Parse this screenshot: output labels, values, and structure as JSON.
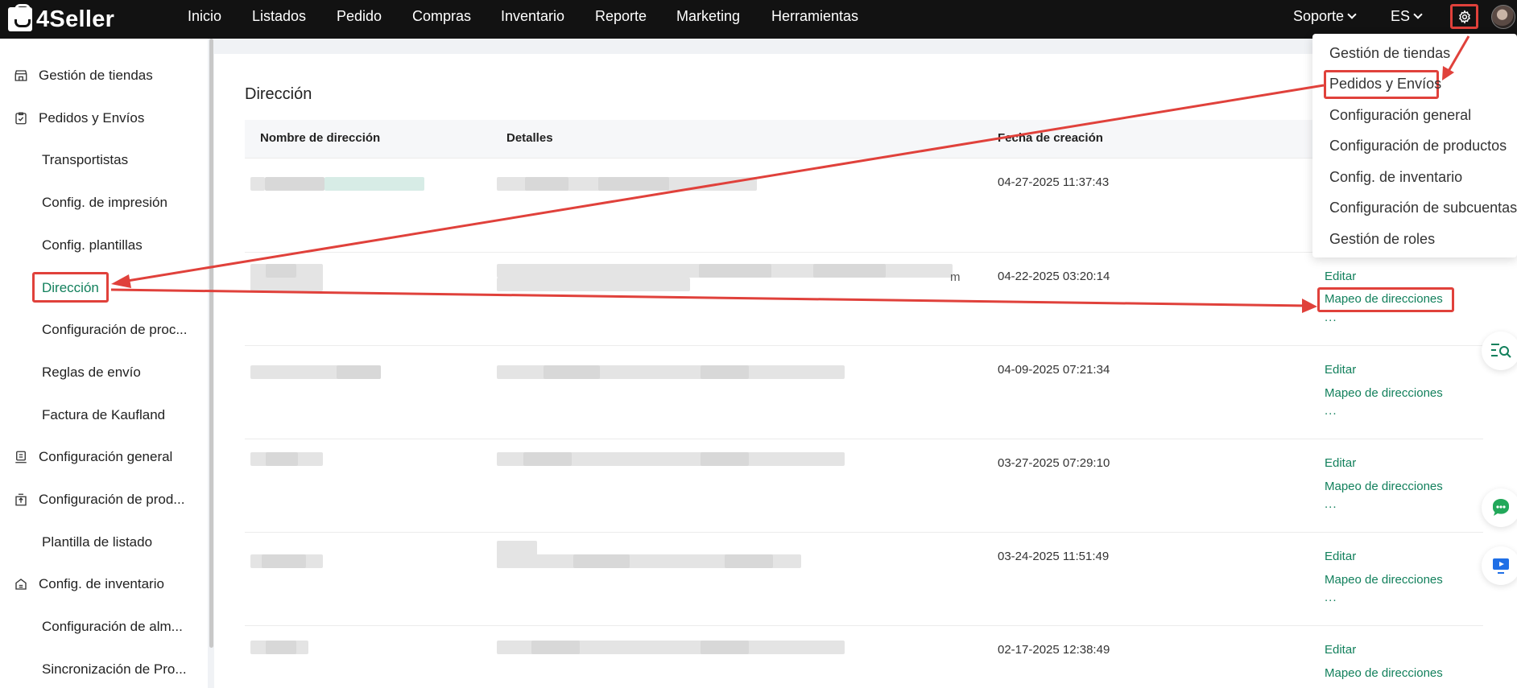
{
  "brand": {
    "name": "4Seller"
  },
  "topnav": {
    "items": [
      "Inicio",
      "Listados",
      "Pedido",
      "Compras",
      "Inventario",
      "Reporte",
      "Marketing",
      "Herramientas"
    ],
    "support": "Soporte",
    "language": "ES"
  },
  "settings_menu": {
    "items": [
      "Gestión de tiendas",
      "Pedidos y Envíos",
      "Configuración general",
      "Configuración de productos",
      "Config. de inventario",
      "Configuración de subcuentas",
      "Gestión de roles"
    ]
  },
  "sidebar": {
    "group_store": "Gestión de tiendas",
    "group_orders": "Pedidos y Envíos",
    "orders_items": [
      "Transportistas",
      "Config. de impresión",
      "Config. plantillas",
      "Dirección",
      "Configuración de proc...",
      "Reglas de envío",
      "Factura de Kaufland"
    ],
    "group_general": "Configuración general",
    "group_products": "Configuración de prod...",
    "products_items": [
      "Plantilla de listado"
    ],
    "group_inventory": "Config. de inventario",
    "inventory_items": [
      "Configuración de alm...",
      "Sincronización de Pro..."
    ]
  },
  "main": {
    "title": "Dirección",
    "columns": [
      "Nombre de dirección",
      "Detalles",
      "Fecha de creación"
    ],
    "rows": [
      {
        "date": "04-27-2025 11:37:43"
      },
      {
        "date": "04-22-2025 03:20:14"
      },
      {
        "date": "04-09-2025 07:21:34"
      },
      {
        "date": "03-27-2025 07:29:10"
      },
      {
        "date": "03-24-2025 11:51:49"
      },
      {
        "date": "02-17-2025 12:38:49"
      }
    ],
    "action_edit": "Editar",
    "action_mapping": "Mapeo de direcciones",
    "action_more": "...",
    "stray_text": "m"
  },
  "colors": {
    "accent_green": "#12805c",
    "highlight_red": "#e0413b",
    "topbar": "#121212"
  },
  "icons": {
    "settings": "gear-icon",
    "search_help": "search-list-icon",
    "chat": "chat-icon",
    "video": "video-play-icon"
  }
}
